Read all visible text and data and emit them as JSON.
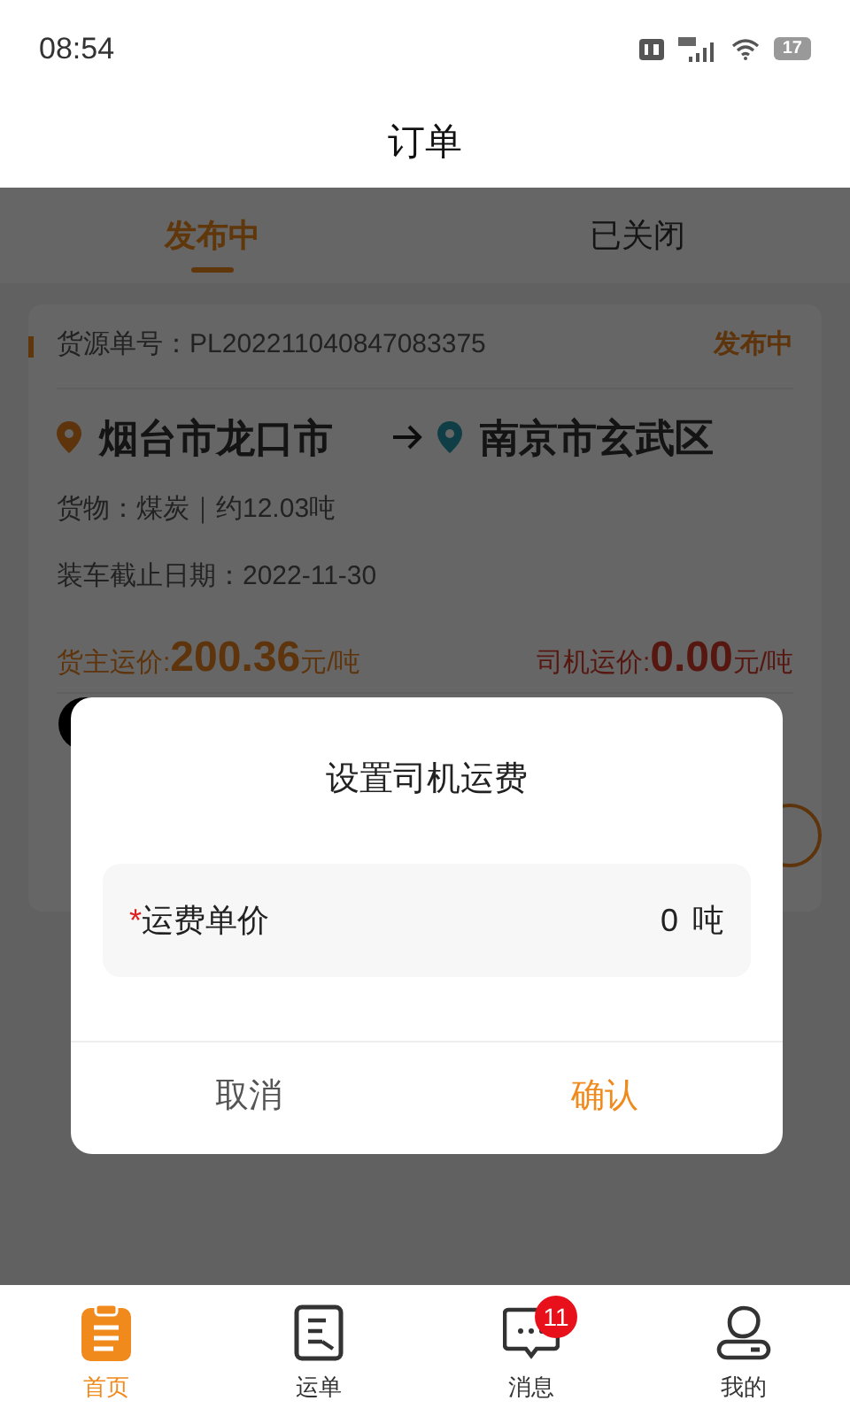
{
  "status_bar": {
    "time": "08:54",
    "battery": "17"
  },
  "header": {
    "title": "订单"
  },
  "tabs": [
    {
      "label": "发布中",
      "selected": true
    },
    {
      "label": "已关闭",
      "selected": false
    }
  ],
  "order": {
    "number": "货源单号：PL202211040847083375",
    "status": "发布中",
    "origin": "烟台市龙口市",
    "destination": "南京市玄武区",
    "cargo": "货物：煤炭｜约12.03吨",
    "deadline": "装车截止日期：2022-11-30",
    "owner_price": {
      "label": "货主运价:",
      "amount": "200.36",
      "unit": "元/吨"
    },
    "driver_price": {
      "label": "司机运价:",
      "amount": "0.00",
      "unit": "元/吨"
    }
  },
  "dialog": {
    "title": "设置司机运费",
    "field": {
      "required_mark": "*",
      "label": "运费单价",
      "value": "0",
      "unit": "吨"
    },
    "buttons": [
      {
        "label": "取消",
        "kind": "cancel"
      },
      {
        "label": "确认",
        "kind": "confirm"
      }
    ]
  },
  "nav": [
    {
      "label": "首页",
      "kind": "home",
      "selected": true
    },
    {
      "label": "运单",
      "kind": "waybill",
      "selected": false
    },
    {
      "label": "消息",
      "kind": "message",
      "selected": false,
      "badge": "11"
    },
    {
      "label": "我的",
      "kind": "profile",
      "selected": false
    }
  ]
}
